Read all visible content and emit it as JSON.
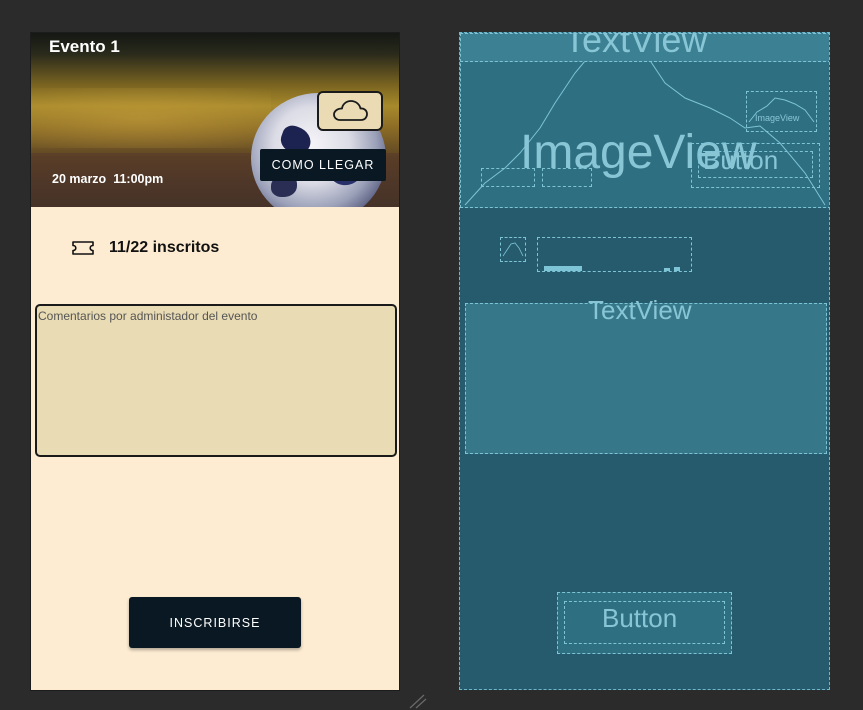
{
  "event": {
    "title": "Evento 1",
    "date": "20 marzo",
    "time": "11:00pm",
    "weather_icon": "cloud-icon",
    "directions_button": "COMO LLEGAR",
    "ticket_icon": "ticket-icon",
    "enrolled_text": "11/22 inscritos",
    "comments_placeholder": "Comentarios por administador del evento",
    "subscribe_button": "INSCRIBIRSE"
  },
  "blueprint": {
    "title_label": "TextView",
    "image_label": "ImageView",
    "small_image_label": "ImageView",
    "button_label": "Button",
    "comments_label": "TextView",
    "bottom_button_label": "Button"
  },
  "colors": {
    "screen_background": "#fdecd2",
    "comments_background": "#e9dbb3",
    "button_dark": "#091822",
    "blueprint_background": "#265b6d",
    "editor_background": "#2b2b2b"
  }
}
